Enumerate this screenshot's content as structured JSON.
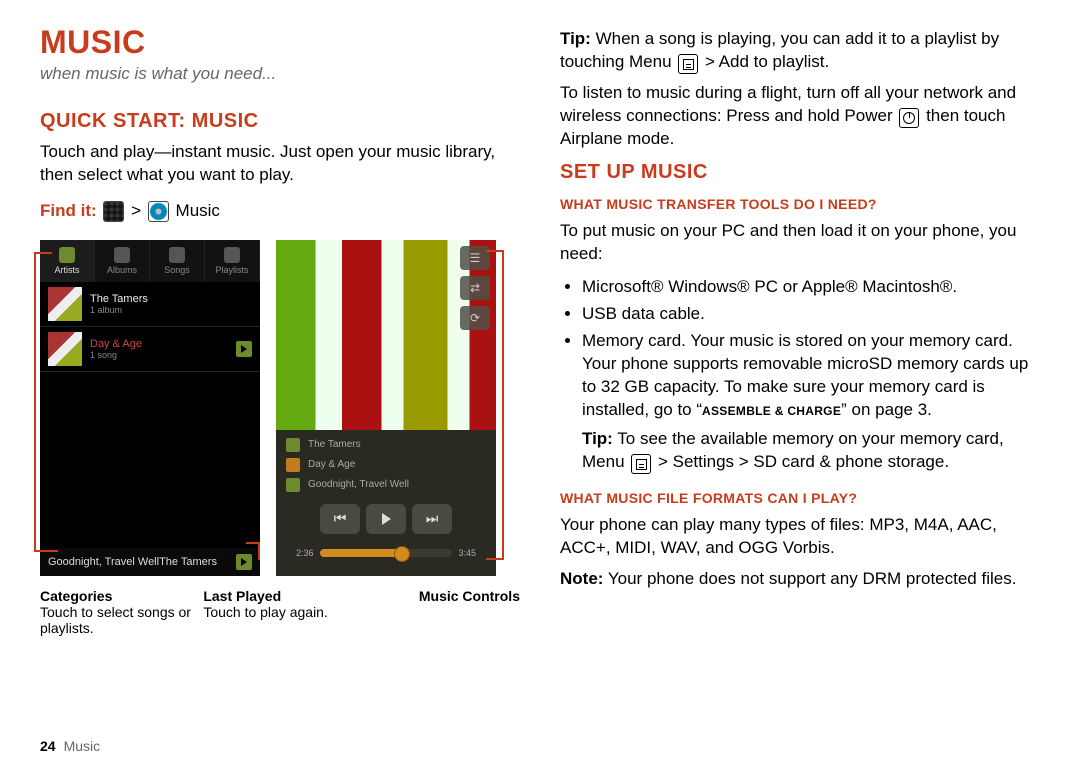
{
  "left": {
    "title": "Music",
    "tagline": "when music is what you need...",
    "quickstart_h": "Quick start: Music",
    "quickstart_p": "Touch and play—instant music. Just open your music library, then select what you want to play.",
    "findit_label": "Find it:",
    "findit_sep": ">",
    "findit_text": "Music",
    "phone1": {
      "tabs": [
        "Artists",
        "Albums",
        "Songs",
        "Playlists"
      ],
      "r1_t": "The Tamers",
      "r1_s": "1 album",
      "r2_t": "Day & Age",
      "r2_s": "1 song",
      "np_t": "Goodnight, Travel Well",
      "np_s": "The Tamers"
    },
    "phone2": {
      "meta_artist": "The Tamers",
      "meta_album": "Day & Age",
      "meta_song": "Goodnight, Travel Well",
      "t_cur": "2:36",
      "t_tot": "3:45"
    },
    "callouts": {
      "c1_h": "Categories",
      "c1_b": "Touch to select songs or playlists.",
      "c2_h": "Last Played",
      "c2_b": "Touch to play again.",
      "c3_h": "Music Controls"
    }
  },
  "right": {
    "tip1_a": "Tip:",
    "tip1_b": " When a song is playing, you can add it to a playlist by touching Menu ",
    "tip1_c": " > Add to playlist.",
    "flight_a": "To listen to music during a flight, turn off all your network and wireless connections: Press and hold Power ",
    "flight_b": " then touch Airplane mode.",
    "setup_h": "Set up music",
    "tools_h": "What music transfer tools do I need?",
    "tools_p": "To put music on your PC and then load it on your phone, you need:",
    "li1": "Microsoft® Windows® PC or Apple® Macintosh®.",
    "li2": "USB data cable.",
    "li3_a": "Memory card. Your music is stored on your memory card. Your phone supports removable microSD memory cards up to 32 GB capacity. To make sure your memory card is installed, go to “",
    "li3_caps": "Assemble & charge",
    "li3_b": "” on page 3.",
    "tip2_a": "Tip:",
    "tip2_b": " To see the available memory on your memory card,  Menu ",
    "tip2_c": " > Settings > SD card & phone storage.",
    "formats_h": "What music file formats can I play?",
    "formats_p": "Your phone can play many types of files: MP3, M4A, AAC, ACC+, MIDI, WAV, and OGG Vorbis.",
    "note_a": "Note:",
    "note_b": " Your phone does not support any DRM protected files."
  },
  "footer": {
    "num": "24",
    "label": "Music"
  }
}
